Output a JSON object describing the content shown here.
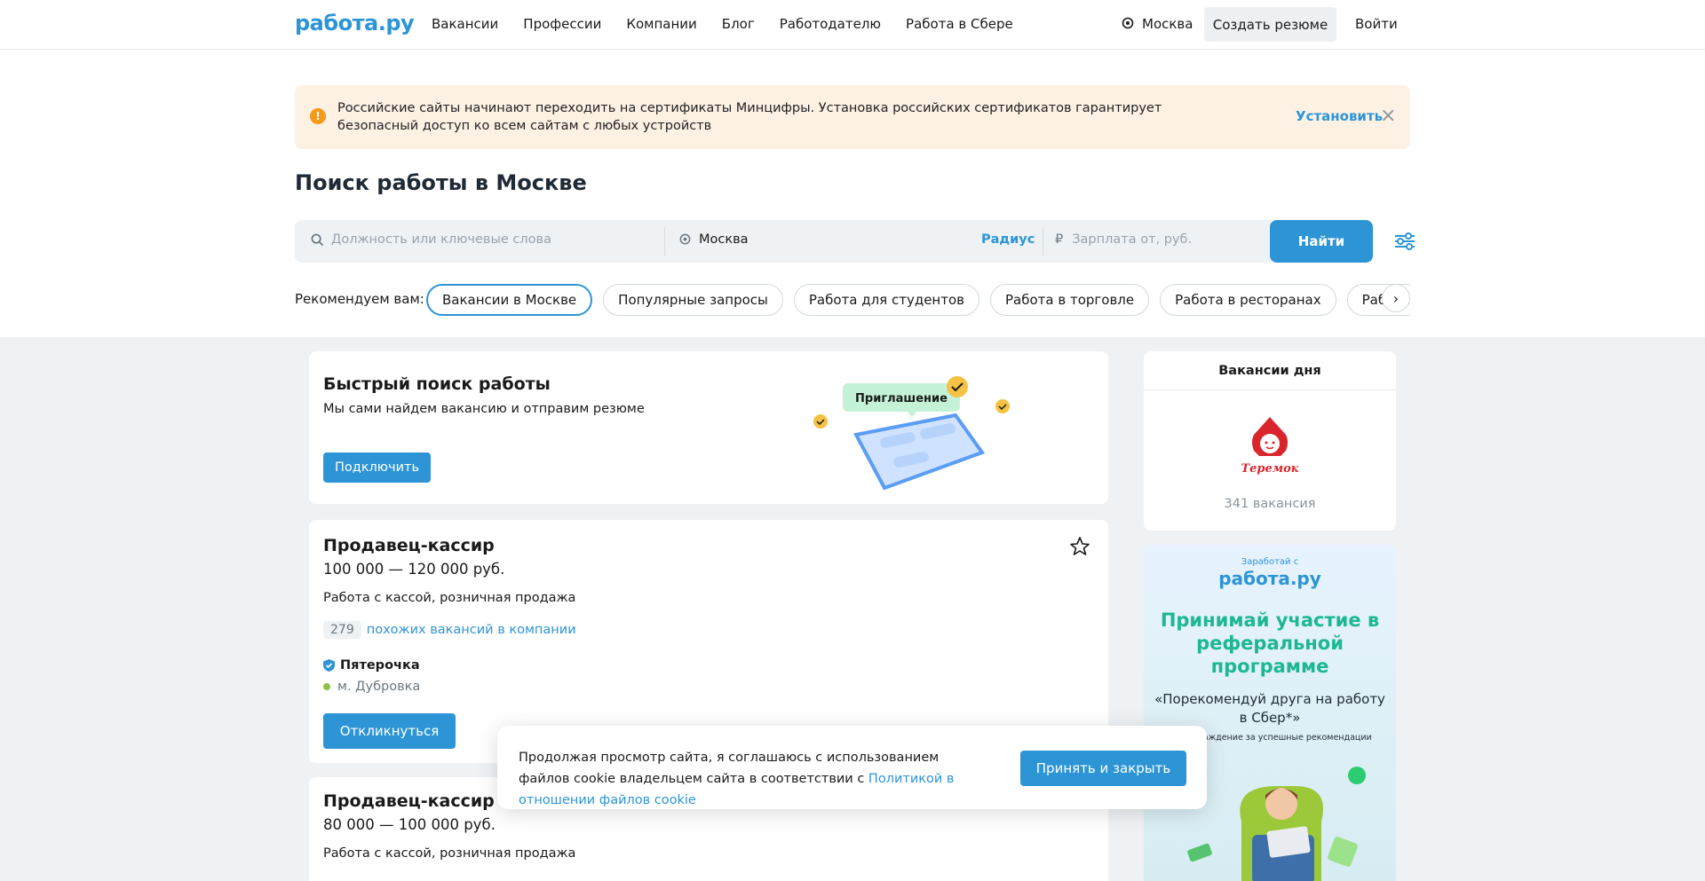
{
  "header": {
    "logo": "работа.ру",
    "nav": [
      "Вакансии",
      "Профессии",
      "Компании",
      "Блог",
      "Работодателю",
      "Работа в Сбере"
    ],
    "city": "Москва",
    "create_resume": "Создать резюме",
    "login": "Войти"
  },
  "notice": {
    "text": "Российские сайты начинают переходить на сертификаты Минцифры. Установка российских сертификатов гарантирует безопасный доступ ко всем сайтам с любых устройств",
    "install": "Установить"
  },
  "page_title": "Поиск работы в Москве",
  "search": {
    "keywords_placeholder": "Должность или ключевые слова",
    "city_value": "Москва",
    "radius": "Радиус",
    "salary_placeholder": "Зарплата от, руб.",
    "find": "Найти"
  },
  "recs": {
    "label": "Рекомендуем вам:",
    "chips": [
      "Вакансии в Москве",
      "Популярные запросы",
      "Работа для студентов",
      "Работа в торговле",
      "Работа в ресторанах",
      "Работа на скл"
    ]
  },
  "quick_search": {
    "title": "Быстрый поиск работы",
    "subtitle": "Мы сами найдем вакансию и отправим резюме",
    "button": "Подключить",
    "bubble": "Приглашение"
  },
  "vacancies": [
    {
      "title": "Продавец-кассир",
      "salary": "100 000 — 120 000 руб.",
      "description": "Работа с кассой, розничная продажа",
      "similar_count": "279",
      "similar_text": "похожих вакансий в компании",
      "company": "Пятерочка",
      "metro": "м. Дубровка",
      "apply": "Откликнуться"
    },
    {
      "title": "Продавец-кассир",
      "salary": "80 000 — 100 000 руб.",
      "description": "Работа с кассой, розничная продажа"
    }
  ],
  "vacancies_of_day": {
    "header": "Вакансии дня",
    "logo_text": "Теремок",
    "count": "341 вакансия"
  },
  "promo": {
    "earn": "Заработай с",
    "logo": "работа.ру",
    "headline": "Принимай участие в реферальной программе",
    "quote": "«Порекомендуй друга на работу в Сбер*»",
    "small": "вознаграждение за успешные рекомендации"
  },
  "cookie": {
    "text": "Продолжая просмотр сайта, я соглашаюсь с использованием файлов cookie владельцем сайта в соответствии с ",
    "link": "Политикой в отношении файлов cookie",
    "button": "Принять и закрыть"
  },
  "colors": {
    "accent": "#2d95d6",
    "notice_bg": "#fdf1e4",
    "content_bg": "#eef2f5",
    "promo_green": "#1db794"
  }
}
